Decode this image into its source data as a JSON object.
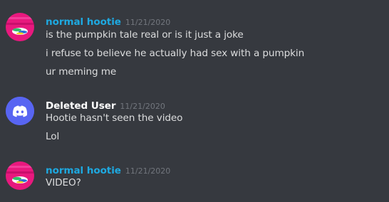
{
  "colors": {
    "background": "#36393f",
    "username_normal_hootie": "#1ea9e1",
    "username_deleted_user": "#ffffff",
    "message_text": "#dcddde",
    "timestamp": "#72767d",
    "discord_blurple": "#5865f2"
  },
  "messages": [
    {
      "author": "normal hootie",
      "timestamp": "11/21/2020",
      "avatar_icon": "hootie-avatar",
      "lines": [
        "is the pumpkin tale real or is it just a joke",
        "i refuse to believe he actually had sex with a pumpkin",
        "ur meming me"
      ]
    },
    {
      "author": "Deleted User",
      "timestamp": "11/21/2020",
      "avatar_icon": "discord-logo-icon",
      "lines": [
        "Hootie hasn't seen the video",
        "Lol"
      ]
    },
    {
      "author": "normal hootie",
      "timestamp": "11/21/2020",
      "avatar_icon": "hootie-avatar",
      "lines": [
        "VIDEO?"
      ]
    }
  ]
}
